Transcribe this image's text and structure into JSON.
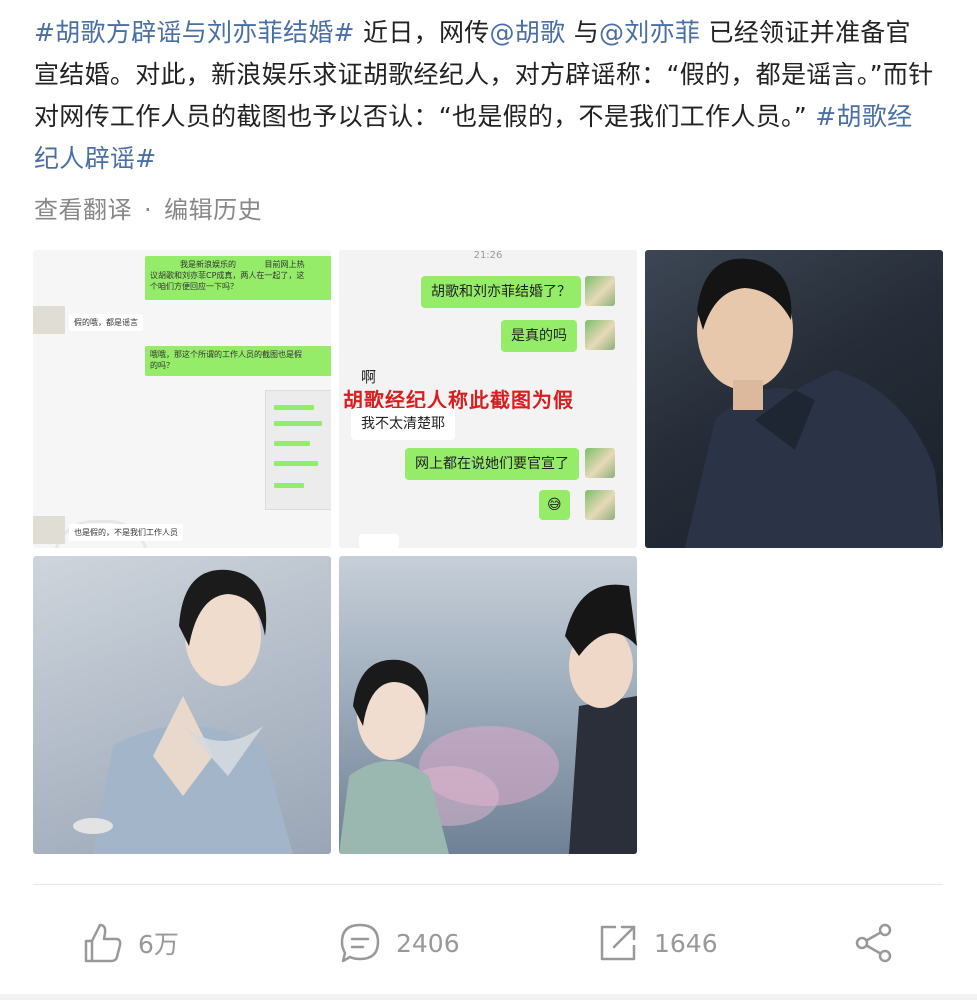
{
  "post": {
    "tag1": "#胡歌方辟谣与刘亦菲结婚#",
    "text1": " 近日，网传",
    "mention1": "@胡歌",
    "text2": " 与",
    "mention2": "@刘亦菲",
    "text3": " 已经领证并准备官宣结婚。对此，新浪娱乐求证胡歌经纪人，对方辟谣称：“假的，都是谣言。”而针对网传工作人员的截图也予以否认：“也是假的，不是我们工作人员。” ",
    "tag2": "#胡歌经纪人辟谣#"
  },
  "meta": {
    "translate": "查看翻译",
    "separator": "·",
    "edit_history": "编辑历史"
  },
  "image1": {
    "chat": [
      "我是新浪娱乐的",
      "目前网上热",
      "议胡歌和刘亦菲CP成真，两人在一起了，这",
      "个咱们方便回应一下吗？",
      "假的哦，都是谣言",
      "哦哦，那这个所谓的工作人员的截图也是假",
      "的吗？",
      "也是假的，不是我们工作人员"
    ]
  },
  "image2": {
    "time": "21:26",
    "msg1": "胡歌和刘亦菲结婚了？",
    "msg2": "是真的吗",
    "reply1": "啊",
    "stamp": "胡歌经纪人称此截图为假",
    "reply2": "我不太清楚耶",
    "msg3": "网上都在说她们要官宣了",
    "msg4": "😅"
  },
  "actions": {
    "like_count": "6万",
    "comment_count": "2406",
    "repost_count": "1646"
  },
  "colors": {
    "link": "#4a6fa5",
    "wechat_green": "#95ec69",
    "stamp_red": "#d81e1e"
  }
}
